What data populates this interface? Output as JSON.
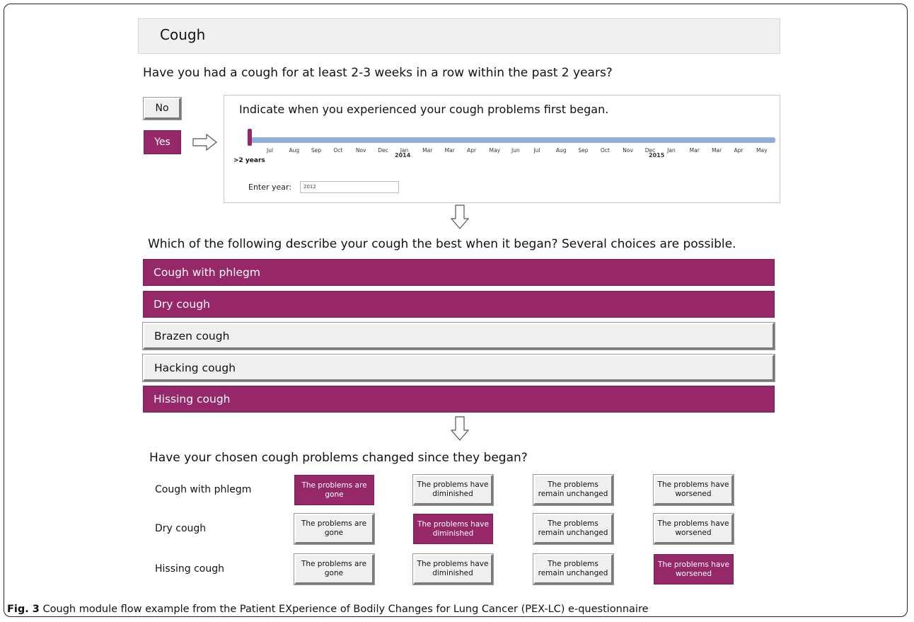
{
  "module": {
    "title": "Cough"
  },
  "q1": {
    "text": "Have you had a cough for at least 2-3 weeks in a row within the past 2 years?",
    "no_label": "No",
    "yes_label": "Yes",
    "selected": "Yes"
  },
  "timeline": {
    "prompt": "Indicate when you experienced your cough problems first began.",
    "months": [
      "Jul",
      "Aug",
      "Sep",
      "Oct",
      "Nov",
      "Dec",
      "Jan",
      "Mar",
      "Mar",
      "Apr",
      "May",
      "Jun",
      "Jul",
      "Aug",
      "Sep",
      "Oct",
      "Nov",
      "Dec",
      "Jan",
      "Mar",
      "Mar",
      "Apr",
      "May"
    ],
    "year_2014": "2014",
    "year_2015": "2015",
    "start_label": ">2 years",
    "enter_year_label": "Enter year:",
    "enter_year_value": "2012",
    "bar_color": "#8fb0dc",
    "marker_color": "#96286a"
  },
  "q2": {
    "text": "Which of the following describe your cough the best when it began? Several choices are possible.",
    "options": [
      {
        "label": "Cough with phlegm",
        "selected": true
      },
      {
        "label": "Dry cough",
        "selected": true
      },
      {
        "label": "Brazen cough",
        "selected": false
      },
      {
        "label": "Hacking cough",
        "selected": false
      },
      {
        "label": "Hissing cough",
        "selected": true
      }
    ]
  },
  "q3": {
    "text": "Have your chosen cough problems changed since they began?",
    "choices": [
      "The problems are gone",
      "The problems have diminished",
      "The problems remain unchanged",
      "The problems have worsened"
    ],
    "rows": [
      {
        "label": "Cough with phlegm",
        "selected_index": 0
      },
      {
        "label": "Dry cough",
        "selected_index": 1
      },
      {
        "label": "Hissing cough",
        "selected_index": 3
      }
    ]
  },
  "caption": {
    "prefix": "Fig. 3",
    "text": " Cough module flow example from the Patient EXperience of Bodily Changes for Lung Cancer (PEX-LC) e-questionnaire"
  },
  "colors": {
    "accent_purple": "#96286a",
    "button_grey": "#efefef"
  }
}
